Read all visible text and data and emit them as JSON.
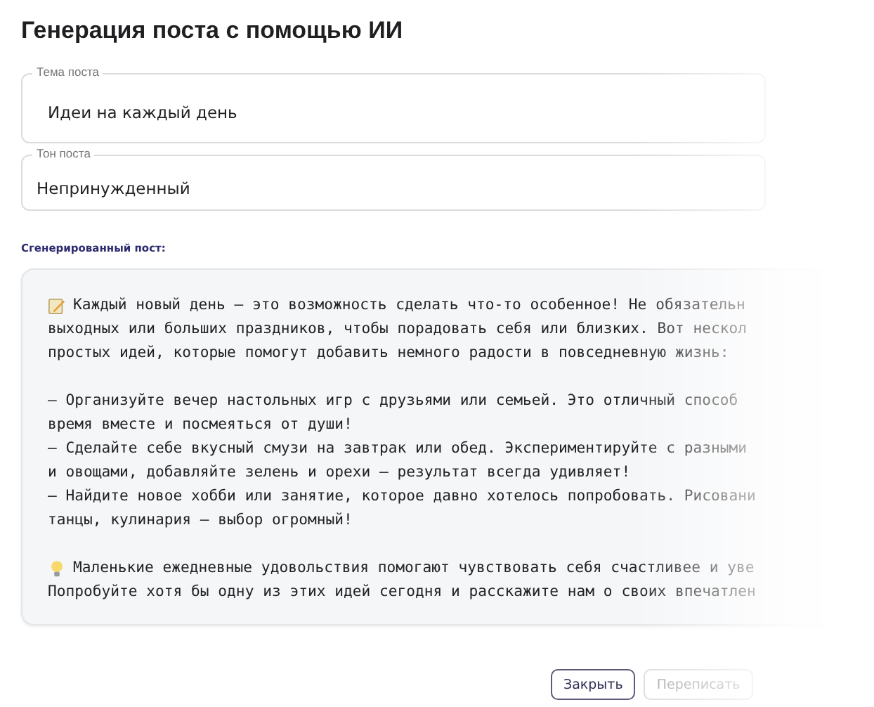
{
  "title": "Генерация поста с помощью ИИ",
  "fields": [
    {
      "label": "Тема поста",
      "value": "Идеи на каждый день"
    },
    {
      "label": "Тон поста",
      "value": "Непринужденный"
    }
  ],
  "post": {
    "label": "Сгенерированный пост:",
    "paragraphs": [
      {
        "kind": "memo",
        "lines": [
          "Каждый новый день — это возможность сделать что-то особенное! Не обязательн",
          "выходных или больших праздников, чтобы порадовать себя или близких. Вот нескол",
          "простых идей, которые помогут добавить немного радости в повседневную жизнь:"
        ]
      },
      {
        "kind": "plain",
        "lines": [
          "— Организуйте вечер настольных игр с друзьями или семьей. Это отличный способ",
          "время вместе и посмеяться от души!",
          "— Сделайте себе вкусный смузи на завтрак или обед. Экспериментируйте с разными",
          "и овощами, добавляйте зелень и орехи — результат всегда удивляет!",
          "— Найдите новое хобби или занятие, которое давно хотелось попробовать. Рисовани",
          "танцы, кулинария — выбор огромный!"
        ]
      },
      {
        "kind": "bulb",
        "lines": [
          "Маленькие ежедневные удовольствия помогают чувствовать себя счастливее и уве",
          "Попробуйте хотя бы одну из этих идей сегодня и расскажите нам о своих впечатлен"
        ]
      }
    ]
  },
  "buttons": [
    {
      "label": "Закрыть",
      "disabled": false
    },
    {
      "label": "Переписать",
      "disabled": true
    }
  ]
}
